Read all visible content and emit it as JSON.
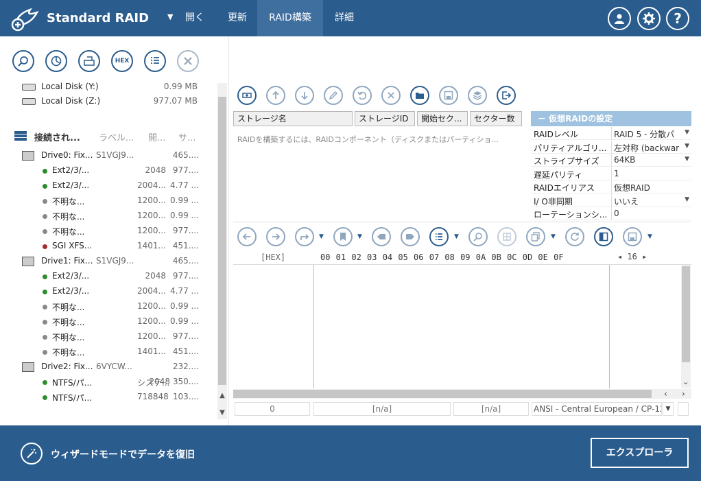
{
  "app": {
    "title": "Standard RAID"
  },
  "menu": {
    "dropdown": "▼",
    "open": "開く",
    "update": "更新",
    "raid_build": "RAID構築",
    "detail": "詳細",
    "help": "?"
  },
  "left_toolbar": {
    "hex_label": "HEX"
  },
  "disks": [
    {
      "name": "Local Disk (Y:)",
      "size": "0.99 MB"
    },
    {
      "name": "Local Disk (Z:)",
      "size": "977.07 MB"
    }
  ],
  "tree_header": {
    "connected": "接続され...",
    "label": "ラベル...",
    "open": "開...",
    "size": "サ..."
  },
  "drives": [
    {
      "name": "Drive0: Fix...",
      "id": "S1VGJ9...",
      "size": "465....",
      "partitions": [
        {
          "name": "Ext2/3/...",
          "start": "2048",
          "size": "977....",
          "color": "#2e8b2e"
        },
        {
          "name": "Ext2/3/...",
          "start": "2004...",
          "size": "4.77 ...",
          "color": "#2e8b2e"
        },
        {
          "name": "不明な...",
          "start": "1200...",
          "size": "0.99 ...",
          "color": "#888888"
        },
        {
          "name": "不明な...",
          "start": "1200...",
          "size": "0.99 ...",
          "color": "#888888"
        },
        {
          "name": "不明な...",
          "start": "1200...",
          "size": "977....",
          "color": "#888888"
        },
        {
          "name": "SGI XFS...",
          "start": "1401...",
          "size": "451....",
          "color": "#a52a2a"
        }
      ]
    },
    {
      "name": "Drive1: Fix...",
      "id": "S1VGJ9...",
      "size": "465....",
      "partitions": [
        {
          "name": "Ext2/3/...",
          "start": "2048",
          "size": "977....",
          "color": "#2e8b2e"
        },
        {
          "name": "Ext2/3/...",
          "start": "2004...",
          "size": "4.77 ...",
          "color": "#2e8b2e"
        },
        {
          "name": "不明な...",
          "start": "1200...",
          "size": "0.99 ...",
          "color": "#888888"
        },
        {
          "name": "不明な...",
          "start": "1200...",
          "size": "0.99 ...",
          "color": "#888888"
        },
        {
          "name": "不明な...",
          "start": "1200...",
          "size": "977....",
          "color": "#888888"
        },
        {
          "name": "不明な...",
          "start": "1401...",
          "size": "451....",
          "color": "#888888"
        }
      ]
    },
    {
      "name": "Drive2: Fix...",
      "id": "6VYCW...",
      "size": "232....",
      "partitions": [
        {
          "name": "NTFS/パ...",
          "start": "システ...",
          "size": "2048 350....",
          "color": "#2e8b2e"
        },
        {
          "name": "NTFS/パ...",
          "start": "718848",
          "size": "103....",
          "color": "#2e8b2e"
        }
      ]
    }
  ],
  "storage_table": {
    "headers": [
      "ストレージ名",
      "ストレージID",
      "開始セク...",
      "セクター数"
    ],
    "empty_message": "RAIDを構築するには、RAIDコンポーネント（ディスクまたはパーティショ..."
  },
  "raid_config": {
    "title": "－  仮想RAIDの設定",
    "rows": [
      {
        "key": "RAIDレベル",
        "value": "RAID 5 - 分散パ",
        "dropdown": true
      },
      {
        "key": "パリティアルゴリ...",
        "value": "左対称 (backwar",
        "dropdown": true
      },
      {
        "key": "ストライプサイズ",
        "value": "64KB",
        "dropdown": true
      },
      {
        "key": "遅延パリティ",
        "value": "1",
        "dropdown": false
      },
      {
        "key": "RAIDエイリアス",
        "value": "仮想RAID",
        "dropdown": false
      },
      {
        "key": "I/ O非同期",
        "value": "いいえ",
        "dropdown": true
      },
      {
        "key": "ローテーションシ...",
        "value": "0",
        "dropdown": false
      }
    ]
  },
  "hex": {
    "label": "[HEX]",
    "columns": "00 01 02 03 04 05 06 07 08 09 0A 0B 0C 0D 0E 0F",
    "width": "◂ 16 ▸"
  },
  "status": {
    "offset": "0",
    "field2": "[n/a]",
    "field3": "[n/a]",
    "encoding": "ANSI - Central European / CP-12"
  },
  "bottom": {
    "wizard": "ウィザードモードでデータを復旧",
    "explorer": "エクスプローラ"
  },
  "colors": {
    "brand": "#2b5c8e",
    "active_tab": "#3f6f9f",
    "cfg_header": "#9fc2e0"
  }
}
